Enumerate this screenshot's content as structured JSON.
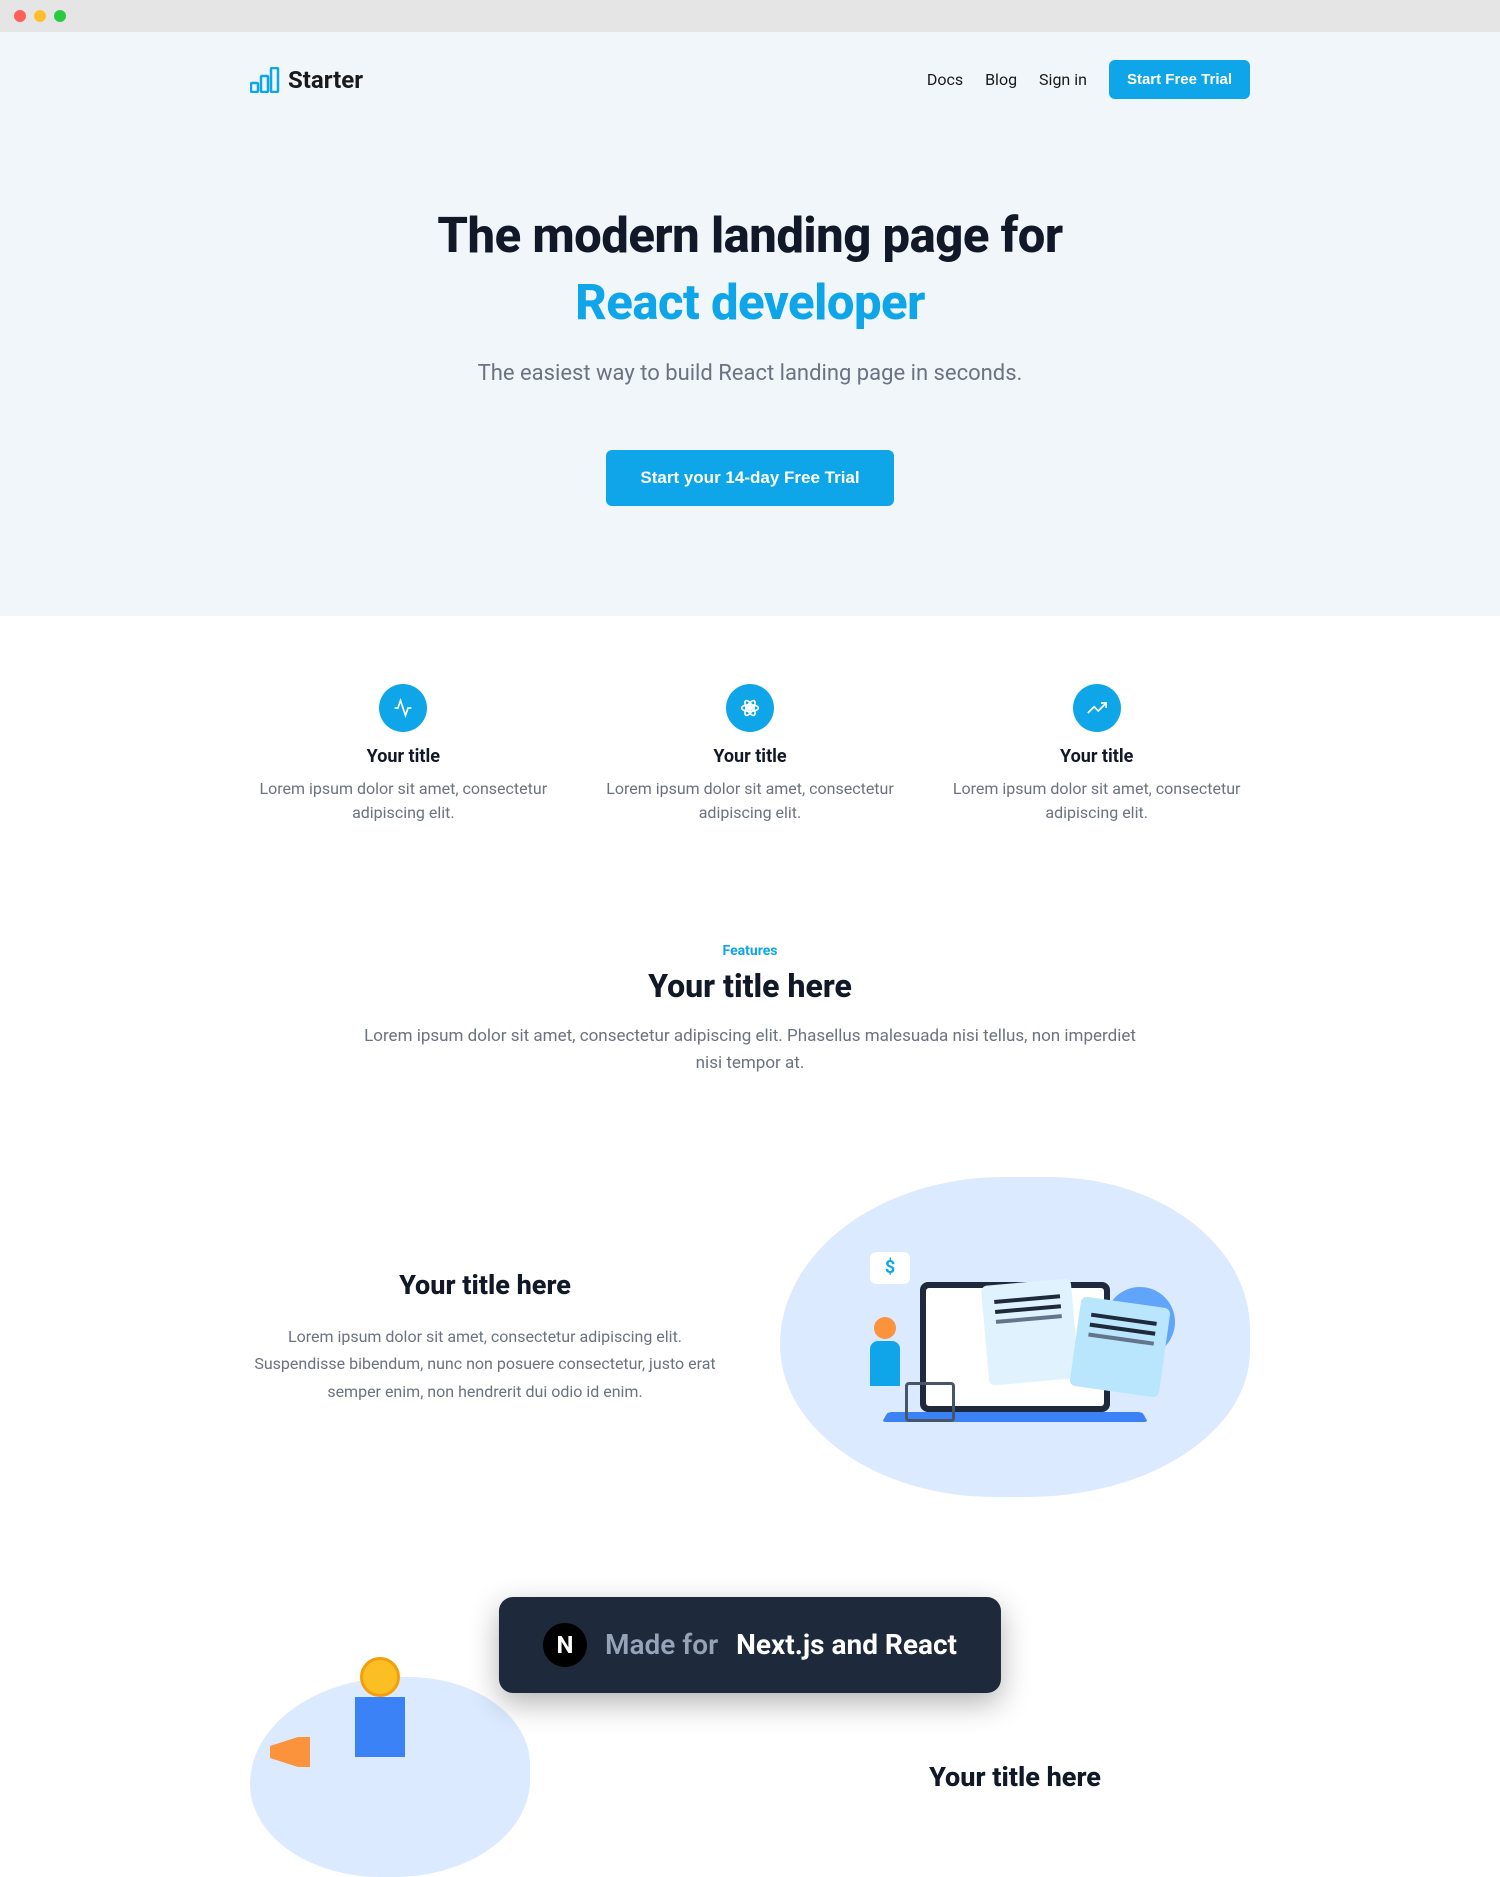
{
  "brand": {
    "name": "Starter"
  },
  "nav": {
    "links": [
      "Docs",
      "Blog",
      "Sign in"
    ],
    "cta": "Start Free Trial"
  },
  "hero": {
    "title_line1": "The modern landing page for",
    "title_line2": "React developer",
    "description": "The easiest way to build React landing page in seconds.",
    "cta": "Start your 14-day Free Trial"
  },
  "features_grid": [
    {
      "title": "Your title",
      "description": "Lorem ipsum dolor sit amet, consectetur adipiscing elit."
    },
    {
      "title": "Your title",
      "description": "Lorem ipsum dolor sit amet, consectetur adipiscing elit."
    },
    {
      "title": "Your title",
      "description": "Lorem ipsum dolor sit amet, consectetur adipiscing elit."
    }
  ],
  "features_section": {
    "eyebrow": "Features",
    "title": "Your title here",
    "description": "Lorem ipsum dolor sit amet, consectetur adipiscing elit. Phasellus malesuada nisi tellus, non imperdiet nisi tempor at."
  },
  "feature_block1": {
    "title": "Your title here",
    "description": "Lorem ipsum dolor sit amet, consectetur adipiscing elit. Suspendisse bibendum, nunc non posuere consectetur, justo erat semper enim, non hendrerit dui odio id enim.",
    "price_symbol": "$"
  },
  "badge": {
    "icon_letter": "N",
    "prefix": "Made for",
    "main": "Next.js and React"
  },
  "feature_block2": {
    "title": "Your title here"
  }
}
